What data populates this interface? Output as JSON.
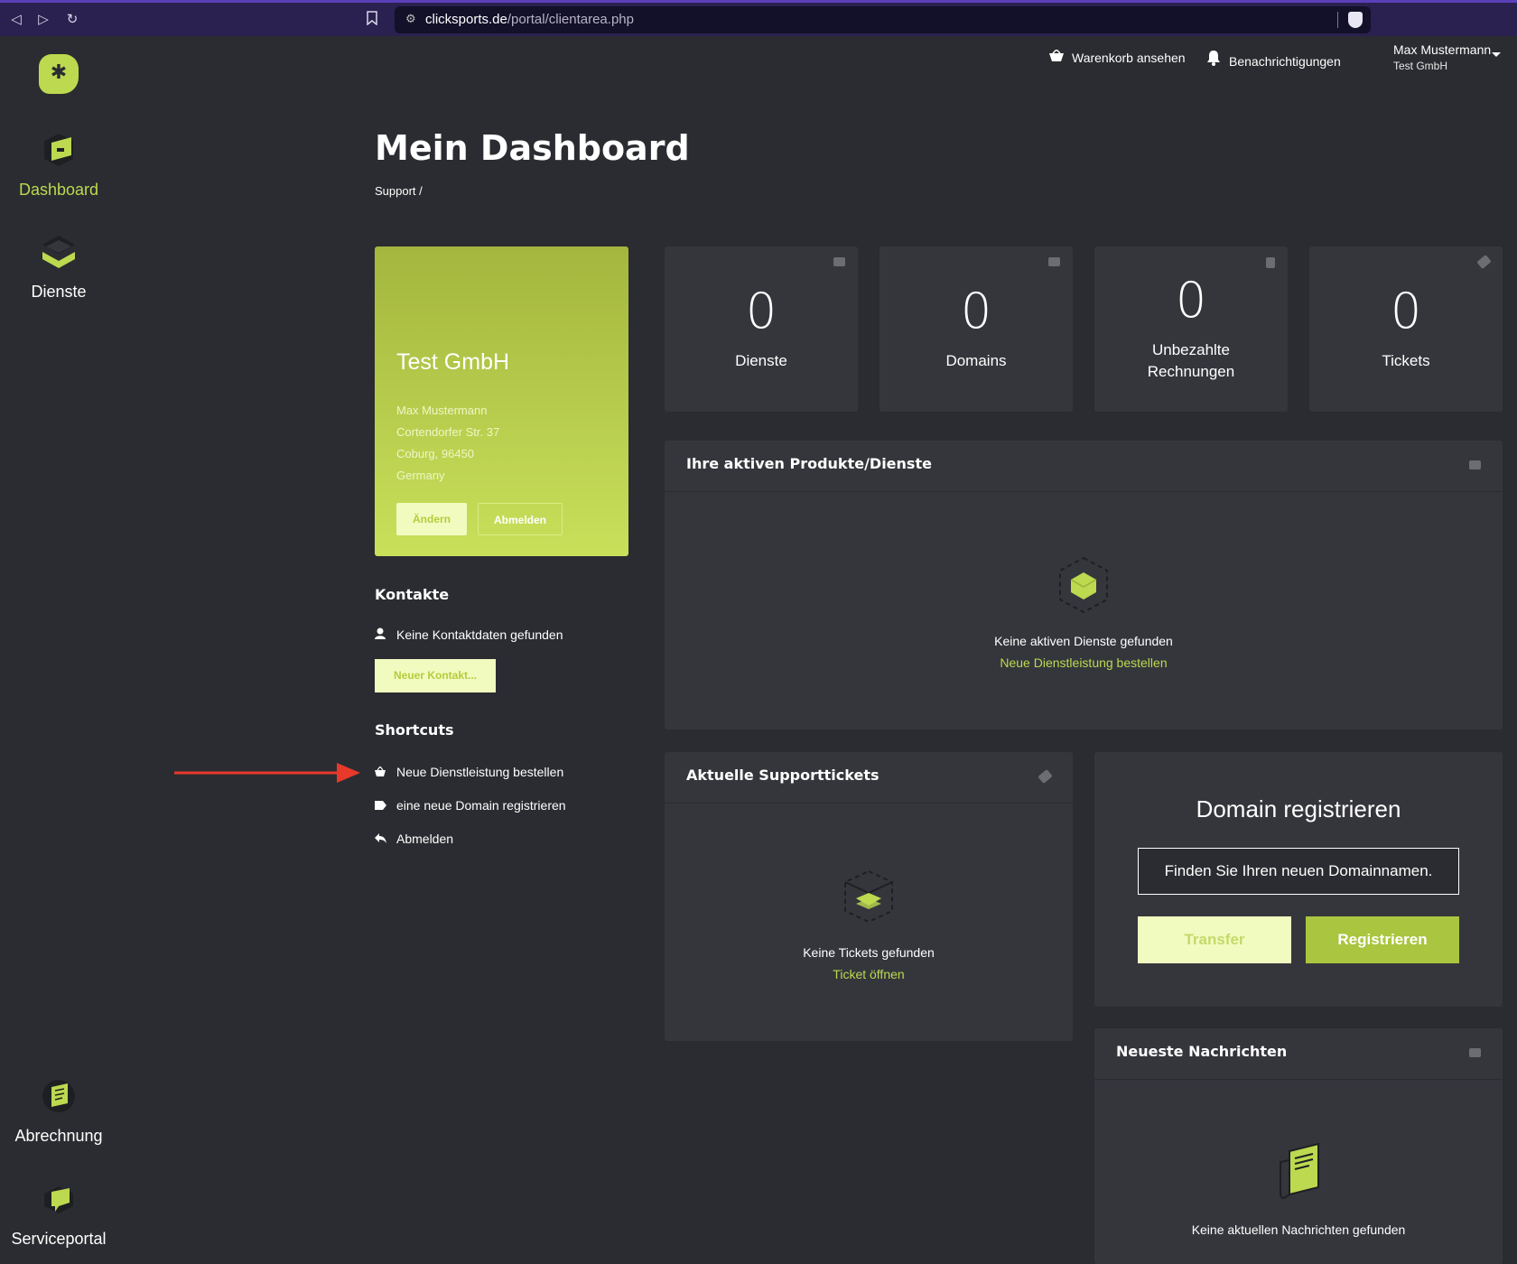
{
  "browser": {
    "url_host": "clicksports.de",
    "url_path": "/portal/clientarea.php",
    "icons": [
      "back-icon",
      "forward-icon",
      "reload-icon",
      "bookmark-icon",
      "site-settings-icon",
      "brave-shield-icon"
    ]
  },
  "sidebar": {
    "items": [
      {
        "label": "Dashboard",
        "icon": "dashboard-icon",
        "active": true
      },
      {
        "label": "Dienste",
        "icon": "services-icon",
        "active": false
      },
      {
        "label": "Abrechnung",
        "icon": "billing-icon",
        "active": false
      },
      {
        "label": "Serviceportal",
        "icon": "support-portal-icon",
        "active": false
      }
    ]
  },
  "header": {
    "cart_label": "Warenkorb ansehen",
    "notifications_label": "Benachrichtigungen",
    "user_name": "Max Mustermann",
    "user_company": "Test GmbH"
  },
  "page": {
    "title": "Mein Dashboard",
    "breadcrumb": "Support /"
  },
  "profile": {
    "company": "Test GmbH",
    "name": "Max Mustermann",
    "street": "Cortendorfer Str. 37",
    "city": "Coburg, 96450",
    "country": "Germany",
    "edit_label": "Ändern",
    "logout_label": "Abmelden"
  },
  "contacts": {
    "heading": "Kontakte",
    "empty": "Keine Kontaktdaten gefunden",
    "new_button": "Neuer Kontakt..."
  },
  "shortcuts": {
    "heading": "Shortcuts",
    "items": [
      {
        "label": "Neue Dienstleistung bestellen",
        "icon": "basket-icon"
      },
      {
        "label": "eine neue Domain registrieren",
        "icon": "tag-icon"
      },
      {
        "label": "Abmelden",
        "icon": "reply-icon"
      }
    ]
  },
  "stats": [
    {
      "value": "0",
      "label": "Dienste",
      "icon": "server-icon"
    },
    {
      "value": "0",
      "label": "Domains",
      "icon": "tag-icon"
    },
    {
      "value": "0",
      "label": "Unbezahlte Rechnungen",
      "icon": "document-icon"
    },
    {
      "value": "0",
      "label": "Tickets",
      "icon": "ticket-icon"
    }
  ],
  "products_panel": {
    "title": "Ihre aktiven Produkte/Dienste",
    "empty": "Keine aktiven Dienste gefunden",
    "link": "Neue Dienstleistung bestellen"
  },
  "tickets_panel": {
    "title": "Aktuelle Supporttickets",
    "empty": "Keine Tickets gefunden",
    "link": "Ticket öffnen"
  },
  "domain_panel": {
    "title": "Domain registrieren",
    "placeholder": "Finden Sie Ihren neuen Domainnamen.",
    "transfer_label": "Transfer",
    "register_label": "Registrieren"
  },
  "news_panel": {
    "title": "Neueste Nachrichten",
    "empty": "Keine aktuellen Nachrichten gefunden"
  },
  "colors": {
    "accent": "#bcd94f",
    "background": "#2b2c31",
    "panel": "#35363c",
    "annotation_arrow": "#e8392b"
  }
}
